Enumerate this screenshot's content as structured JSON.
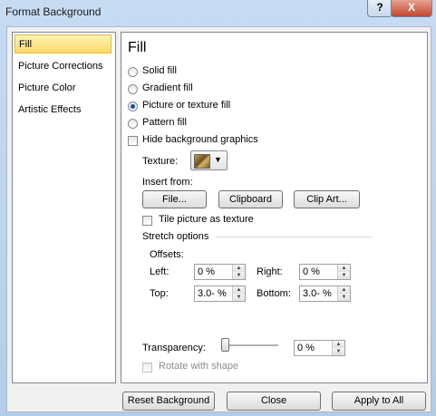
{
  "window": {
    "title": "Format Background",
    "help_label": "?",
    "close_label": "X"
  },
  "nav": {
    "items": [
      {
        "label": "Fill"
      },
      {
        "label": "Picture Corrections"
      },
      {
        "label": "Picture Color"
      },
      {
        "label": "Artistic Effects"
      }
    ]
  },
  "fill": {
    "heading": "Fill",
    "options": [
      {
        "label": "Solid fill",
        "selected": false
      },
      {
        "label": "Gradient fill",
        "selected": false
      },
      {
        "label": "Picture or texture fill",
        "selected": true
      },
      {
        "label": "Pattern fill",
        "selected": false
      }
    ],
    "hide_background_label": "Hide background graphics",
    "texture_label": "Texture:",
    "insert_from_label": "Insert from:",
    "file_button": "File...",
    "clipboard_button": "Clipboard",
    "clipart_button": "Clip Art...",
    "tile_label": "Tile picture as texture",
    "stretch_label": "Stretch options",
    "offsets_label": "Offsets:",
    "left_label": "Left:",
    "left_value": "0 %",
    "right_label": "Right:",
    "right_value": "0 %",
    "top_label": "Top:",
    "top_value": "3.0- %",
    "bottom_label": "Bottom:",
    "bottom_value": "3.0- %",
    "transparency_label": "Transparency:",
    "transparency_value": "0 %",
    "rotate_label": "Rotate with shape"
  },
  "footer": {
    "reset_button": "Reset Background",
    "close_button": "Close",
    "apply_all_button": "Apply to All"
  }
}
